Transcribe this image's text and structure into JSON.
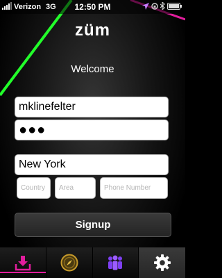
{
  "status_bar": {
    "carrier": "Verizon",
    "network": "3G",
    "time": "12:50 PM"
  },
  "app": {
    "logo": "züm",
    "welcome": "Welcome"
  },
  "form": {
    "username": "mklinefelter",
    "password": "●●●",
    "city": "New York",
    "country_placeholder": "Country",
    "area_placeholder": "Area",
    "phone_placeholder": "Phone Number",
    "signup_label": "Signup"
  },
  "tabbar": {
    "tabs": [
      {
        "icon": "download-icon",
        "active": false
      },
      {
        "icon": "compass-icon",
        "active": false
      },
      {
        "icon": "people-icon",
        "active": false
      },
      {
        "icon": "gear-icon",
        "active": true
      }
    ]
  },
  "colors": {
    "accent_pink": "#e11d9c",
    "neon_green": "#22ff2a",
    "people_purple": "#7e3ff2",
    "compass_gold": "#c69a2a"
  }
}
